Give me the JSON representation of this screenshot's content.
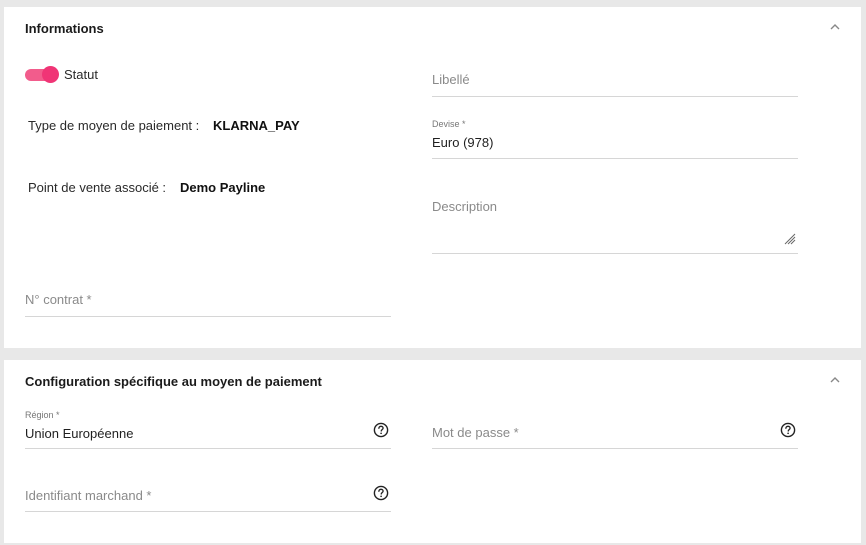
{
  "info_section": {
    "title": "Informations",
    "status_label": "Statut",
    "status_on": true,
    "payment_type_label": "Type de moyen de paiement :",
    "payment_type_value": "KLARNA_PAY",
    "pos_label": "Point de vente associé :",
    "pos_value": "Demo Payline",
    "libelle_placeholder": "Libellé",
    "devise_label": "Devise *",
    "devise_value": "Euro (978)",
    "description_placeholder": "Description",
    "contract_placeholder": "N° contrat *"
  },
  "config_section": {
    "title": "Configuration spécifique au moyen de paiement",
    "region_label": "Région *",
    "region_value": "Union Européenne",
    "password_placeholder": "Mot de passe *",
    "merchant_id_placeholder": "Identifiant marchand *"
  },
  "icons": {
    "collapse": "chevron-up-icon",
    "help": "question-circle-icon",
    "resize": "resize-handle-icon"
  },
  "colors": {
    "toggle_accent": "#f03576",
    "toggle_track": "#f25c8c"
  }
}
